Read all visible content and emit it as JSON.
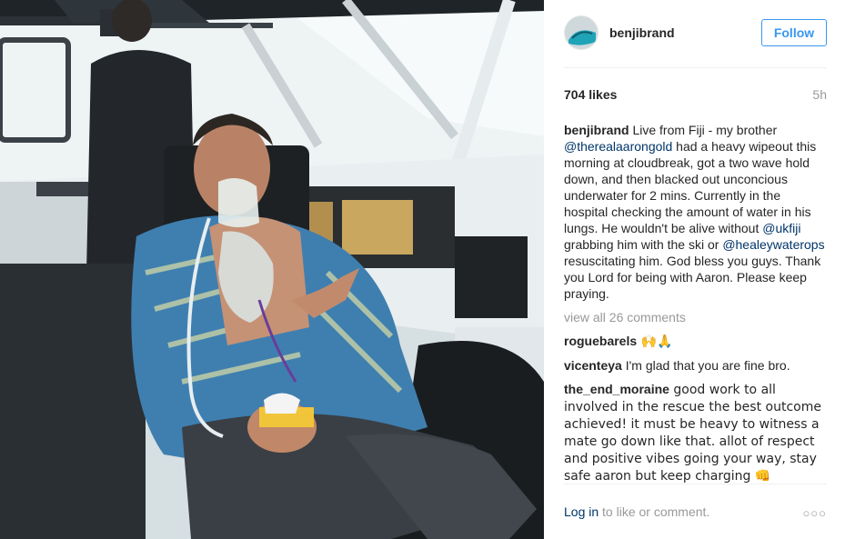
{
  "post": {
    "username": "benjibrand",
    "follow_label": "Follow",
    "likes": "704 likes",
    "time": "5h"
  },
  "caption": {
    "username": "benjibrand",
    "t1": " Live from Fiji - my brother ",
    "m1": "@therealaarongold",
    "t2": " had a heavy wipeout this morning at cloudbreak, got a two wave hold down, and then blacked out unconcious underwater for 2 mins. Currently in the hospital checking the amount of water in his lungs. He wouldn't be alive without ",
    "m2": "@ukfiji",
    "t3": " grabbing him with the ski or ",
    "m3": "@healeywaterops",
    "t4": " resuscitating him. God bless you guys. Thank you Lord for being with Aaron. Please keep praying."
  },
  "view_all": "view all 26 comments",
  "comments": [
    {
      "username": "roguebarels",
      "text": " 🙌🙏"
    },
    {
      "username": "vicenteya",
      "text": " I'm glad that you are fine bro."
    },
    {
      "username": "the_end_moraine",
      "text": " good work to all involved in the rescue the best outcome achieved! it must be heavy to witness a mate go down like that. allot of respect and positive vibes going your way, stay safe aaron but keep charging 👊"
    }
  ],
  "footer": {
    "login": "Log in",
    "rest": " to like or comment.",
    "more": "○○○"
  },
  "icons": {
    "more": "ellipsis-icon"
  },
  "colors": {
    "accent": "#3897f0",
    "link": "#003569",
    "muted": "#999999"
  }
}
